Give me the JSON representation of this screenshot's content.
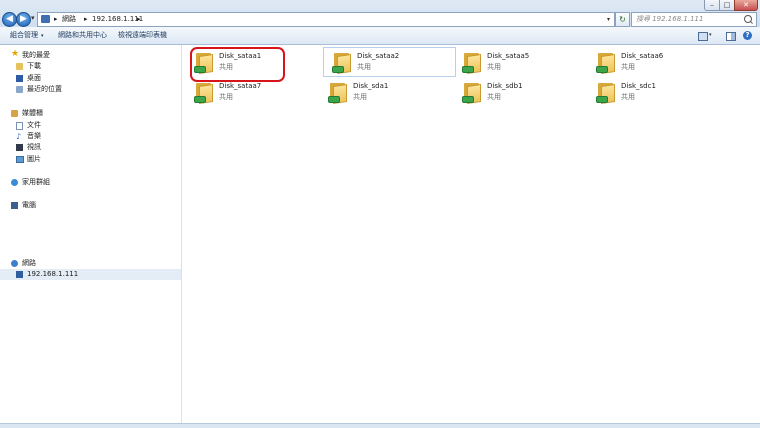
{
  "window": {
    "minimize": "–",
    "maximize": "□",
    "close": "✕"
  },
  "nav": {
    "back_glyph": "◀",
    "forward_glyph": "▶",
    "dropdown_glyph": "▾"
  },
  "address": {
    "icon": "network-icon",
    "separator": "▸",
    "segments": [
      "網路",
      "192.168.1.111"
    ],
    "dropdown_glyph": "▾"
  },
  "refresh_glyph": "↻",
  "search": {
    "placeholder": "搜尋 192.168.1.111"
  },
  "commandbar": {
    "organize": "組合管理",
    "caret": "▾",
    "sharing": "網路和共用中心",
    "printers": "檢視遠端印表機",
    "view_caret": "▾",
    "help": "?"
  },
  "sidebar": {
    "favorites": {
      "label": "我的最愛",
      "icon": "star-icon",
      "items": [
        {
          "label": "下載",
          "icon": "downloads-folder-icon"
        },
        {
          "label": "桌面",
          "icon": "desktop-icon"
        },
        {
          "label": "最近的位置",
          "icon": "recent-places-icon"
        }
      ]
    },
    "libraries": {
      "label": "媒體櫃",
      "icon": "library-icon",
      "items": [
        {
          "label": "文件",
          "icon": "document-icon"
        },
        {
          "label": "音樂",
          "icon": "music-icon"
        },
        {
          "label": "視訊",
          "icon": "video-icon"
        },
        {
          "label": "圖片",
          "icon": "picture-icon"
        }
      ]
    },
    "homegroup": {
      "label": "家用群組",
      "icon": "homegroup-icon"
    },
    "computer": {
      "label": "電腦",
      "icon": "computer-icon"
    },
    "network": {
      "label": "網路",
      "icon": "network-icon",
      "items": [
        {
          "label": "192.168.1.111",
          "icon": "host-icon",
          "selected": true
        }
      ]
    }
  },
  "shares": [
    {
      "name": "Disk_sataa1",
      "subtitle": "共用",
      "highlighted": true
    },
    {
      "name": "Disk_sataa2",
      "subtitle": "共用",
      "hovered": true
    },
    {
      "name": "Disk_sataa5",
      "subtitle": "共用"
    },
    {
      "name": "Disk_sataa6",
      "subtitle": "共用"
    },
    {
      "name": "Disk_sataa7",
      "subtitle": "共用"
    },
    {
      "name": "Disk_sda1",
      "subtitle": "共用"
    },
    {
      "name": "Disk_sdb1",
      "subtitle": "共用"
    },
    {
      "name": "Disk_sdc1",
      "subtitle": "共用"
    }
  ],
  "colors": {
    "annotation": "#d7141a",
    "accent": "#1e395b",
    "selection": "#e4ecf6"
  }
}
